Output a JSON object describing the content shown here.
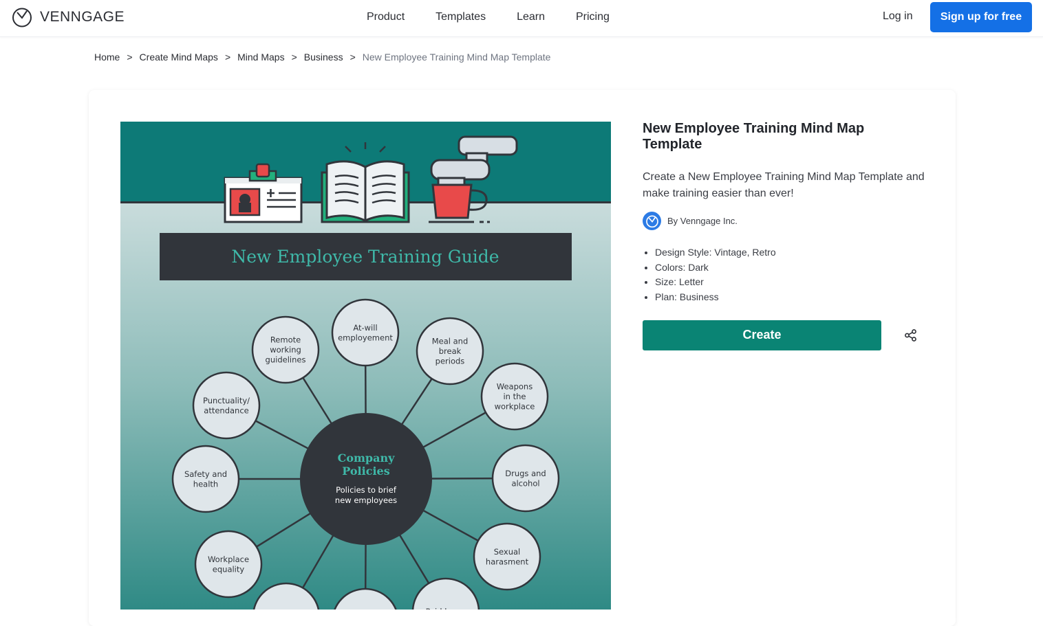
{
  "brand": {
    "name": "VENNGAGE"
  },
  "nav": {
    "links": [
      "Product",
      "Templates",
      "Learn",
      "Pricing"
    ],
    "login": "Log in",
    "signup": "Sign up for free"
  },
  "breadcrumb": {
    "items": [
      "Home",
      "Create Mind Maps",
      "Mind Maps",
      "Business"
    ],
    "separator": ">",
    "current": "New Employee Training Mind Map Template"
  },
  "template": {
    "title": "New Employee Training Mind Map Template",
    "description": "Create a New Employee Training Mind Map Template and make training easier than ever!",
    "author": "By Venngage Inc.",
    "details": [
      "Design Style: Vintage, Retro",
      "Colors: Dark",
      "Size: Letter",
      "Plan: Business"
    ],
    "create_label": "Create",
    "share_icon": "share-icon"
  },
  "preview": {
    "banner_title": "New Employee Training Guide",
    "center_title": "Company Policies",
    "center_subtitle": "Policies to brief new employees",
    "nodes": [
      "At-will employement",
      "Meal and break periods",
      "Weapons in the workplace",
      "Drugs and alcohol",
      "Sexual harasment",
      "Paid leave",
      "Workplace equality",
      "Safety and health",
      "Punctuality/ attendance",
      "Remote working guidelines"
    ],
    "colors": {
      "teal": "#0d7a77",
      "dark": "#31353b",
      "node": "#dfe6ea",
      "accent_text": "#3fb9a9"
    }
  }
}
